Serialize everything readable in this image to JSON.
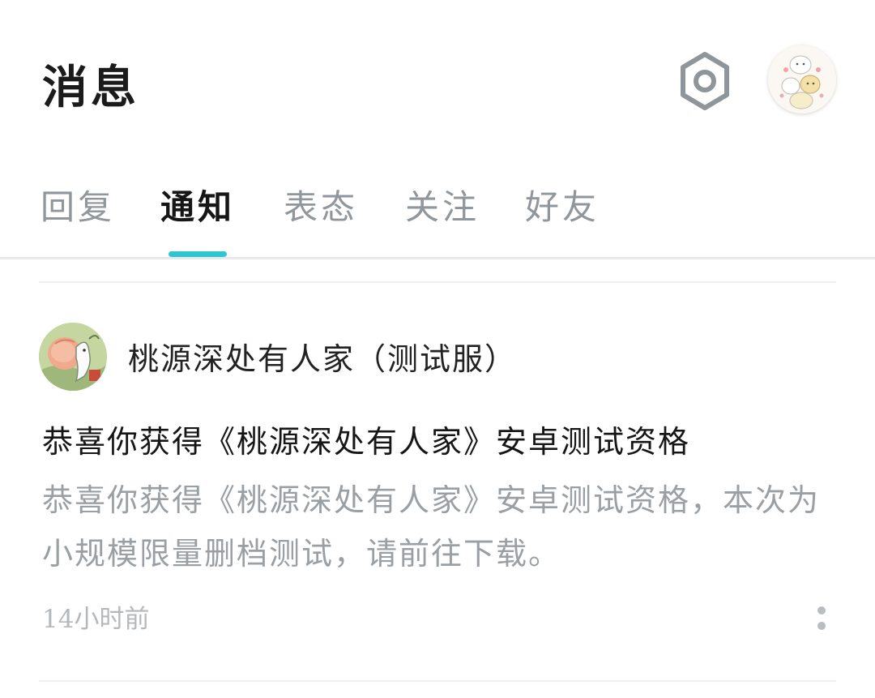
{
  "header": {
    "title": "消息",
    "settings_icon": "hexagon-settings-icon",
    "avatar_icon": "user-avatar-icon"
  },
  "tabs": [
    {
      "label": "回复",
      "active": false
    },
    {
      "label": "通知",
      "active": true
    },
    {
      "label": "表态",
      "active": false
    },
    {
      "label": "关注",
      "active": false
    },
    {
      "label": "好友",
      "active": false
    }
  ],
  "notification": {
    "sender": "桃源深处有人家（测试服）",
    "title": "恭喜你获得《桃源深处有人家》安卓测试资格",
    "body": "恭喜你获得《桃源深处有人家》安卓测试资格，本次为小规模限量删档测试，请前往下载。",
    "time": "14小时前",
    "more_icon": "more-vertical-icon"
  },
  "colors": {
    "accent": "#2ec6d0",
    "text_primary": "#161616",
    "text_secondary": "#9a9fa4",
    "text_tertiary": "#b4b8bc",
    "tab_inactive": "#8f969c",
    "divider": "#e7e9eb"
  }
}
